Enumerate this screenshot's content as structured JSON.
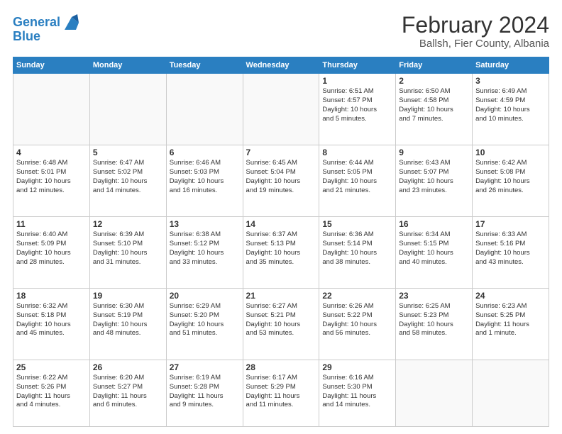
{
  "logo": {
    "line1": "General",
    "line2": "Blue"
  },
  "title": "February 2024",
  "subtitle": "Ballsh, Fier County, Albania",
  "weekdays": [
    "Sunday",
    "Monday",
    "Tuesday",
    "Wednesday",
    "Thursday",
    "Friday",
    "Saturday"
  ],
  "weeks": [
    [
      {
        "day": "",
        "info": ""
      },
      {
        "day": "",
        "info": ""
      },
      {
        "day": "",
        "info": ""
      },
      {
        "day": "",
        "info": ""
      },
      {
        "day": "1",
        "info": "Sunrise: 6:51 AM\nSunset: 4:57 PM\nDaylight: 10 hours\nand 5 minutes."
      },
      {
        "day": "2",
        "info": "Sunrise: 6:50 AM\nSunset: 4:58 PM\nDaylight: 10 hours\nand 7 minutes."
      },
      {
        "day": "3",
        "info": "Sunrise: 6:49 AM\nSunset: 4:59 PM\nDaylight: 10 hours\nand 10 minutes."
      }
    ],
    [
      {
        "day": "4",
        "info": "Sunrise: 6:48 AM\nSunset: 5:01 PM\nDaylight: 10 hours\nand 12 minutes."
      },
      {
        "day": "5",
        "info": "Sunrise: 6:47 AM\nSunset: 5:02 PM\nDaylight: 10 hours\nand 14 minutes."
      },
      {
        "day": "6",
        "info": "Sunrise: 6:46 AM\nSunset: 5:03 PM\nDaylight: 10 hours\nand 16 minutes."
      },
      {
        "day": "7",
        "info": "Sunrise: 6:45 AM\nSunset: 5:04 PM\nDaylight: 10 hours\nand 19 minutes."
      },
      {
        "day": "8",
        "info": "Sunrise: 6:44 AM\nSunset: 5:05 PM\nDaylight: 10 hours\nand 21 minutes."
      },
      {
        "day": "9",
        "info": "Sunrise: 6:43 AM\nSunset: 5:07 PM\nDaylight: 10 hours\nand 23 minutes."
      },
      {
        "day": "10",
        "info": "Sunrise: 6:42 AM\nSunset: 5:08 PM\nDaylight: 10 hours\nand 26 minutes."
      }
    ],
    [
      {
        "day": "11",
        "info": "Sunrise: 6:40 AM\nSunset: 5:09 PM\nDaylight: 10 hours\nand 28 minutes."
      },
      {
        "day": "12",
        "info": "Sunrise: 6:39 AM\nSunset: 5:10 PM\nDaylight: 10 hours\nand 31 minutes."
      },
      {
        "day": "13",
        "info": "Sunrise: 6:38 AM\nSunset: 5:12 PM\nDaylight: 10 hours\nand 33 minutes."
      },
      {
        "day": "14",
        "info": "Sunrise: 6:37 AM\nSunset: 5:13 PM\nDaylight: 10 hours\nand 35 minutes."
      },
      {
        "day": "15",
        "info": "Sunrise: 6:36 AM\nSunset: 5:14 PM\nDaylight: 10 hours\nand 38 minutes."
      },
      {
        "day": "16",
        "info": "Sunrise: 6:34 AM\nSunset: 5:15 PM\nDaylight: 10 hours\nand 40 minutes."
      },
      {
        "day": "17",
        "info": "Sunrise: 6:33 AM\nSunset: 5:16 PM\nDaylight: 10 hours\nand 43 minutes."
      }
    ],
    [
      {
        "day": "18",
        "info": "Sunrise: 6:32 AM\nSunset: 5:18 PM\nDaylight: 10 hours\nand 45 minutes."
      },
      {
        "day": "19",
        "info": "Sunrise: 6:30 AM\nSunset: 5:19 PM\nDaylight: 10 hours\nand 48 minutes."
      },
      {
        "day": "20",
        "info": "Sunrise: 6:29 AM\nSunset: 5:20 PM\nDaylight: 10 hours\nand 51 minutes."
      },
      {
        "day": "21",
        "info": "Sunrise: 6:27 AM\nSunset: 5:21 PM\nDaylight: 10 hours\nand 53 minutes."
      },
      {
        "day": "22",
        "info": "Sunrise: 6:26 AM\nSunset: 5:22 PM\nDaylight: 10 hours\nand 56 minutes."
      },
      {
        "day": "23",
        "info": "Sunrise: 6:25 AM\nSunset: 5:23 PM\nDaylight: 10 hours\nand 58 minutes."
      },
      {
        "day": "24",
        "info": "Sunrise: 6:23 AM\nSunset: 5:25 PM\nDaylight: 11 hours\nand 1 minute."
      }
    ],
    [
      {
        "day": "25",
        "info": "Sunrise: 6:22 AM\nSunset: 5:26 PM\nDaylight: 11 hours\nand 4 minutes."
      },
      {
        "day": "26",
        "info": "Sunrise: 6:20 AM\nSunset: 5:27 PM\nDaylight: 11 hours\nand 6 minutes."
      },
      {
        "day": "27",
        "info": "Sunrise: 6:19 AM\nSunset: 5:28 PM\nDaylight: 11 hours\nand 9 minutes."
      },
      {
        "day": "28",
        "info": "Sunrise: 6:17 AM\nSunset: 5:29 PM\nDaylight: 11 hours\nand 11 minutes."
      },
      {
        "day": "29",
        "info": "Sunrise: 6:16 AM\nSunset: 5:30 PM\nDaylight: 11 hours\nand 14 minutes."
      },
      {
        "day": "",
        "info": ""
      },
      {
        "day": "",
        "info": ""
      }
    ]
  ]
}
